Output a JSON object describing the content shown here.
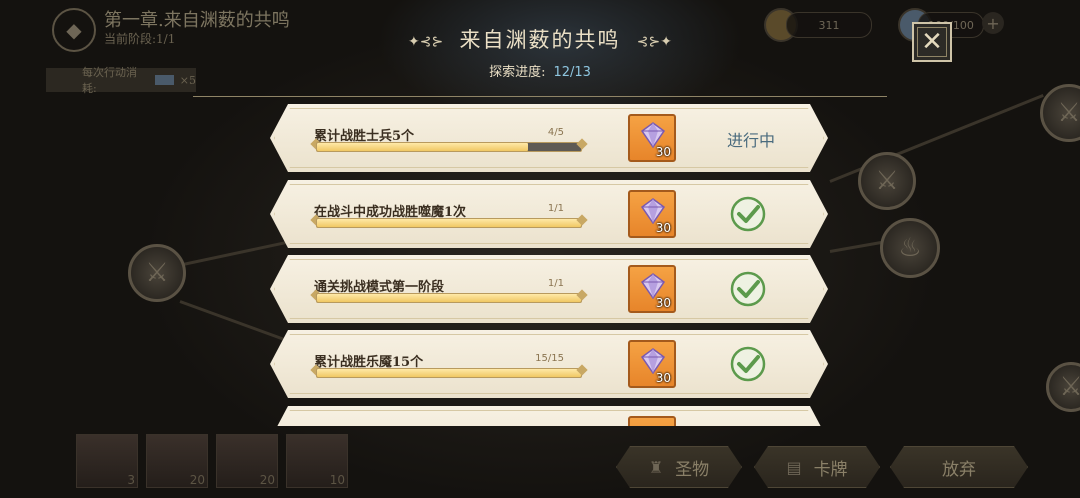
{
  "hud": {
    "chapter_title": "第一章.来自渊薮的共鸣",
    "stage": "当前阶段:1/1",
    "cost_label": "每次行动消耗:",
    "cost_value": "×5",
    "resource_1": "311",
    "resource_2": "100/100"
  },
  "modal": {
    "title": "来自渊薮的共鸣",
    "progress_label": "探索进度:",
    "progress_value": "12/13",
    "close_icon": "close-x-icon"
  },
  "tasks": [
    {
      "name": "累计战胜士兵5个",
      "count": "4/5",
      "progress": 0.8,
      "reward_qty": "30",
      "status": "进行中",
      "completed": false
    },
    {
      "name": "在战斗中成功战胜噬魔1次",
      "count": "1/1",
      "progress": 1.0,
      "reward_qty": "30",
      "status": "",
      "completed": true
    },
    {
      "name": "通关挑战模式第一阶段",
      "count": "1/1",
      "progress": 1.0,
      "reward_qty": "30",
      "status": "",
      "completed": true
    },
    {
      "name": "累计战胜乐魇15个",
      "count": "15/15",
      "progress": 1.0,
      "reward_qty": "30",
      "status": "",
      "completed": true
    }
  ],
  "team": [
    "3",
    "20",
    "20",
    "10"
  ],
  "bottom_buttons": {
    "relic": "圣物",
    "cards": "卡牌",
    "abandon": "放弃"
  },
  "colors": {
    "card_bg": "#f2ebda",
    "reward_bg": "#f09a3c",
    "check_green": "#5c9a4c",
    "in_progress_text": "#4a6b7e"
  }
}
